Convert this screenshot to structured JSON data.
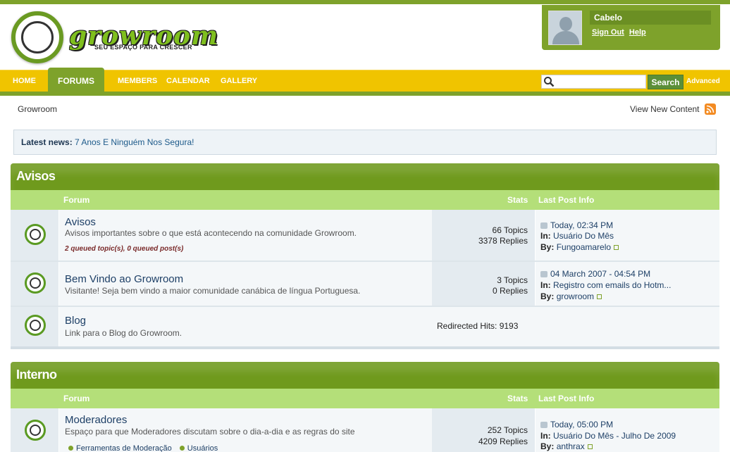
{
  "header": {
    "logo_word": "growroom",
    "logo_tagline": "SEU ESPAÇO PARA CRESCER",
    "user": {
      "name": "Cabelo",
      "sign_out": "Sign Out",
      "help": "Help"
    }
  },
  "nav": {
    "items": [
      "HOME",
      "FORUMS",
      "MEMBERS",
      "CALENDAR",
      "GALLERY"
    ],
    "active": "FORUMS",
    "search_value": "",
    "search_button": "Search",
    "advanced": "Advanced"
  },
  "breadcrumb": "Growroom",
  "view_new_content": "View New Content",
  "news": {
    "label": "Latest news:",
    "link": "7 Anos E Ninguém Nos Segura!"
  },
  "columns": {
    "forum": "Forum",
    "stats": "Stats",
    "last_post": "Last Post Info"
  },
  "categories": [
    {
      "title": "Avisos",
      "forums": [
        {
          "title": "Avisos",
          "desc": "Avisos importantes sobre o que está acontecendo na comunidade Growroom.",
          "queued": "2 queued topic(s), 0 queued post(s)",
          "topics": "66 Topics",
          "replies": "3378 Replies",
          "last_date": "Today, 02:34 PM",
          "in_label": "In:",
          "in_value": "Usuário Do Mês",
          "by_label": "By:",
          "by_value": "Fungoamarelo"
        },
        {
          "title": "Bem Vindo ao Growroom",
          "desc": "Visitante! Seja bem vindo a maior comunidade canábica de língua Portuguesa.",
          "topics": "3 Topics",
          "replies": "0 Replies",
          "last_date": "04 March 2007 - 04:54 PM",
          "in_label": "In:",
          "in_value": "Registro com emails do Hotm...",
          "by_label": "By:",
          "by_value": "growroom"
        },
        {
          "title": "Blog",
          "desc": "Link para o Blog do Growroom.",
          "redirect": "Redirected Hits: 9193"
        }
      ]
    },
    {
      "title": "Interno",
      "forums": [
        {
          "title": "Moderadores",
          "desc": "Espaço para que Moderadores discutam sobre o dia-a-dia e as regras do site",
          "subforums": [
            "Ferramentas de Moderação",
            "Usuários"
          ],
          "topics": "252 Topics",
          "replies": "4209 Replies",
          "last_date": "Today, 05:00 PM",
          "in_label": "In:",
          "in_value": "Usuário Do Mês - Julho De 2009",
          "by_label": "By:",
          "by_value": "anthrax"
        }
      ]
    }
  ]
}
